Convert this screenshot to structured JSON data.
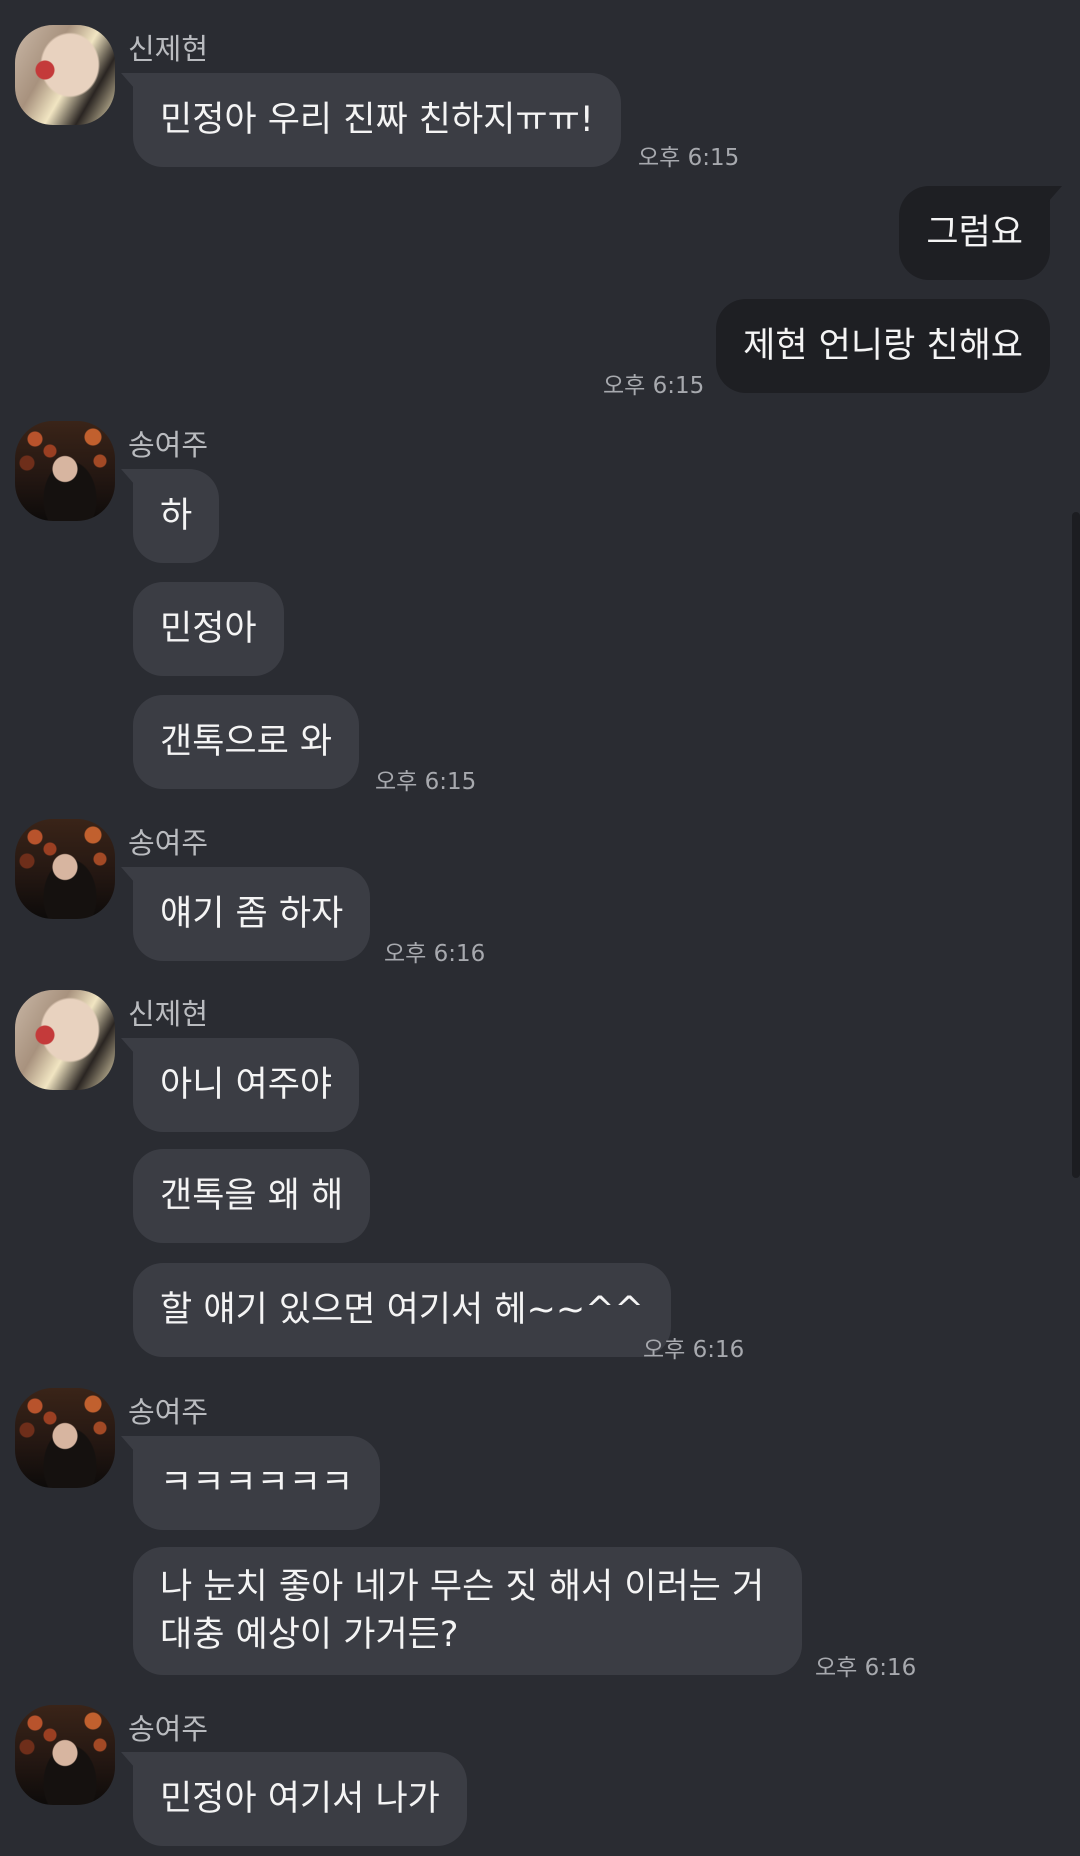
{
  "senders": {
    "jehyun": "신제현",
    "yeoju": "송여주"
  },
  "messages": [
    {
      "text": "민정아 우리 진짜 친하지ㅠㅠ!",
      "time": "오후 6:15"
    },
    {
      "text": "그럼요"
    },
    {
      "text": "제현 언니랑 친해요",
      "time": "오후 6:15"
    },
    {
      "text": "하"
    },
    {
      "text": "민정아"
    },
    {
      "text": "갠톡으로 와",
      "time": "오후 6:15"
    },
    {
      "text": "얘기 좀 하자",
      "time": "오후 6:16"
    },
    {
      "text": "아니 여주야"
    },
    {
      "text": "갠톡을 왜 해"
    },
    {
      "text": "할 얘기 있으면 여기서 헤~~^^",
      "time": "오후 6:16"
    },
    {
      "text": "ㅋㅋㅋㅋㅋㅋ"
    },
    {
      "text": "나 눈치 좋아 네가 무슨 짓 해서 이러는 거 대충 예상이 가거든?",
      "time": "오후 6:16"
    },
    {
      "text": "민정아 여기서 나가"
    }
  ]
}
